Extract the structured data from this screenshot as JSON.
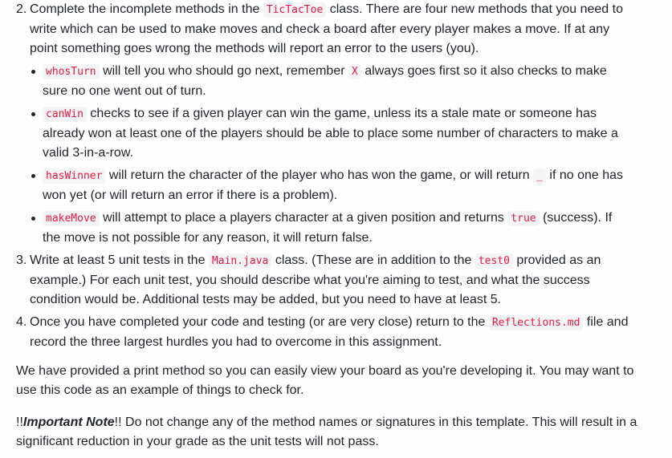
{
  "steps": [
    {
      "number": "2.",
      "lines": [
        [
          "Complete the incomplete methods in the ",
          {
            "code": "TicTacToe"
          },
          " class. There are four new methods that you need to"
        ],
        [
          "write which can be used to make moves and check a board after every player makes a move. If at any"
        ],
        [
          "point something goes wrong the methods will report an error to the users (you)."
        ]
      ],
      "bullets": [
        {
          "code": "whosTurn",
          "lines": [
            [
              " will tell you who should go next, remember ",
              {
                "code": "X"
              },
              " always goes first so it also checks to make"
            ],
            [
              "sure no one went out of turn."
            ]
          ]
        },
        {
          "code": "canWin",
          "lines": [
            [
              " checks to see if a given player can win the game, unless its a stale mate or someone has"
            ],
            [
              "already won at least one of the players should be able to place some number of characters to make a"
            ],
            [
              "valid 3-in-a-row."
            ]
          ]
        },
        {
          "code": "hasWinner",
          "lines": [
            [
              " will return the character of the player who has won the game, or will return ",
              {
                "code": "_"
              },
              " if no one has"
            ],
            [
              "won yet (or will return an error if there is a problem)."
            ]
          ]
        },
        {
          "code": "makeMove",
          "lines": [
            [
              " will attempt to place a players character at a given position and returns ",
              {
                "code": "true"
              },
              " (success). If"
            ],
            [
              "the move is not possible for any reason, it will return false."
            ]
          ]
        }
      ]
    },
    {
      "number": "3.",
      "lines": [
        [
          "Write at least 5 unit tests in the ",
          {
            "code": "Main.java"
          },
          " class. (These are in addition to the ",
          {
            "code": "test0"
          },
          " provided as an"
        ],
        [
          "example.) For each unit test, you should describe what you're aiming to test, and what the success"
        ],
        [
          "condition would be. Additional tests may be added, but you need to have at least 5."
        ]
      ]
    },
    {
      "number": "4.",
      "lines": [
        [
          "Once you have completed your code and testing (or are very close) return to the ",
          {
            "code": "Reflections.md"
          },
          " file and"
        ],
        [
          "record the three largest hurdles you had to overcome in this assignment."
        ]
      ]
    }
  ],
  "paragraphs": {
    "print_method": {
      "line1": "We have provided a print method so you can easily view your board as you're developing it. You may want to",
      "line2": "use this code as an example of things to check for."
    },
    "important_note": {
      "prefix": "!!",
      "emphasis": "Important Note",
      "suffix": "!!",
      "line1_rest": " Do not change any of the method names or signatures in this template. This will result in a",
      "line2": "significant reduction in your grade as the unit tests will not pass."
    }
  },
  "colors": {
    "text": "#1f2328",
    "code_text": "#e8173f",
    "code_bg": "#f3f4f6",
    "page_bg": "#fefefe"
  }
}
